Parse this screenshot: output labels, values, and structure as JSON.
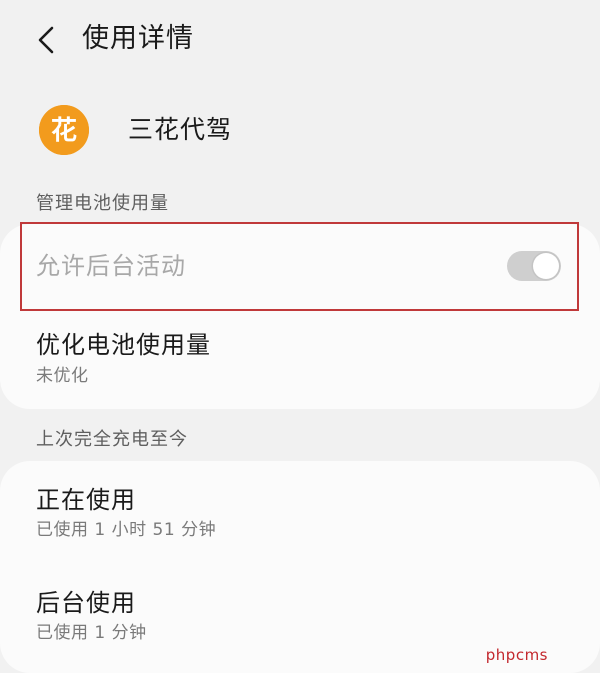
{
  "header": {
    "title": "使用详情",
    "back_icon": "chevron-left-icon"
  },
  "app": {
    "name": "三花代驾",
    "icon_glyph": "花",
    "icon_color": "#f29b1d"
  },
  "battery_section": {
    "label": "管理电池使用量",
    "allow_background": {
      "label": "允许后台活动",
      "enabled": false,
      "toggle_on": true
    },
    "optimize": {
      "title": "优化电池使用量",
      "subtitle": "未优化"
    }
  },
  "since_charge_section": {
    "label": "上次完全充电至今",
    "rows": [
      {
        "title": "正在使用",
        "subtitle": "已使用 1 小时 51 分钟"
      },
      {
        "title": "后台使用",
        "subtitle": "已使用 1 分钟"
      }
    ]
  },
  "highlight_color": "#c0393a",
  "watermark": "phpcms"
}
